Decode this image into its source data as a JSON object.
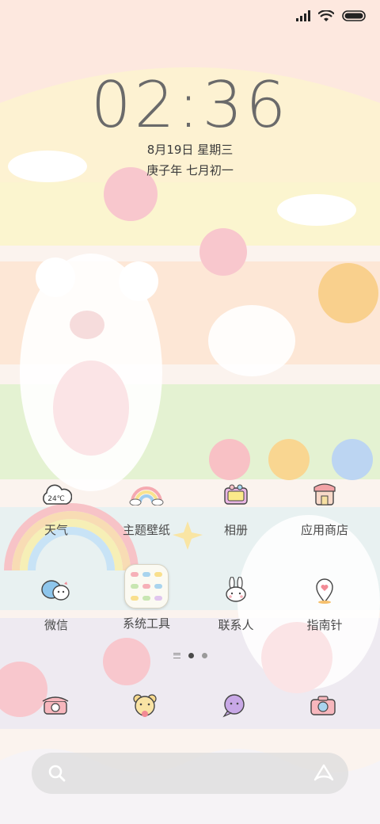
{
  "status": {
    "signal_icon": "signal-icon",
    "wifi_icon": "wifi-icon",
    "battery_icon": "battery-icon"
  },
  "clock": {
    "time": "02:36",
    "date": "8月19日 星期三",
    "lunar": "庚子年 七月初一"
  },
  "apps": [
    {
      "label": "天气",
      "icon": "weather-cloud-icon",
      "badge": "24℃"
    },
    {
      "label": "主题壁纸",
      "icon": "rainbow-icon"
    },
    {
      "label": "相册",
      "icon": "photo-album-icon"
    },
    {
      "label": "应用商店",
      "icon": "app-store-icon"
    },
    {
      "label": "微信",
      "icon": "chat-bubbles-icon"
    },
    {
      "label": "系统工具",
      "icon": "folder-icon"
    },
    {
      "label": "联系人",
      "icon": "bunny-icon"
    },
    {
      "label": "指南针",
      "icon": "map-pin-icon"
    }
  ],
  "pager": {
    "pages": 2,
    "active": 1
  },
  "dock": [
    {
      "icon": "phone-icon"
    },
    {
      "icon": "bear-face-icon"
    },
    {
      "icon": "message-bubble-icon"
    },
    {
      "icon": "camera-icon"
    }
  ],
  "search": {
    "search_icon": "search-icon",
    "assistant_icon": "assistant-icon"
  }
}
